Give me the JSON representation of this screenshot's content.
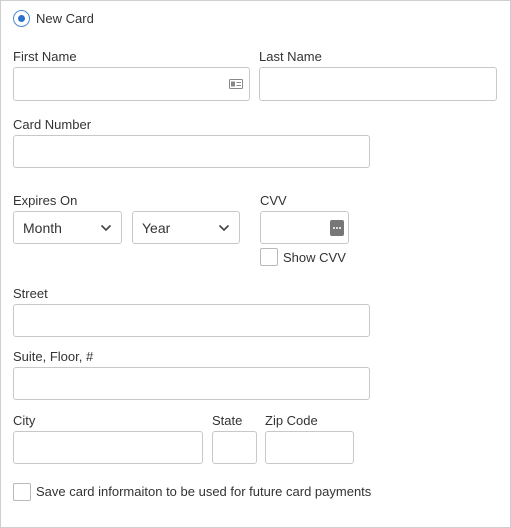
{
  "payment_option": {
    "label": "New Card",
    "selected": true
  },
  "fields": {
    "first_name": {
      "label": "First Name",
      "value": "",
      "icon": "contact-card-icon"
    },
    "last_name": {
      "label": "Last Name",
      "value": ""
    },
    "card_number": {
      "label": "Card Number",
      "value": ""
    },
    "expires": {
      "label": "Expires On",
      "month": "Month",
      "year": "Year"
    },
    "cvv": {
      "label": "CVV",
      "value": "",
      "icon": "dots-icon",
      "show_label": "Show CVV",
      "show_checked": false
    },
    "street": {
      "label": "Street",
      "value": ""
    },
    "suite": {
      "label": "Suite, Floor, #",
      "value": ""
    },
    "city": {
      "label": "City",
      "value": ""
    },
    "state": {
      "label": "State",
      "value": ""
    },
    "zip": {
      "label": "Zip Code",
      "value": ""
    }
  },
  "save_card": {
    "label": "Save card informaiton to be used for future card payments",
    "checked": false
  },
  "colors": {
    "accent": "#2a73c9",
    "border": "#c8c8c8",
    "text": "#333333"
  }
}
